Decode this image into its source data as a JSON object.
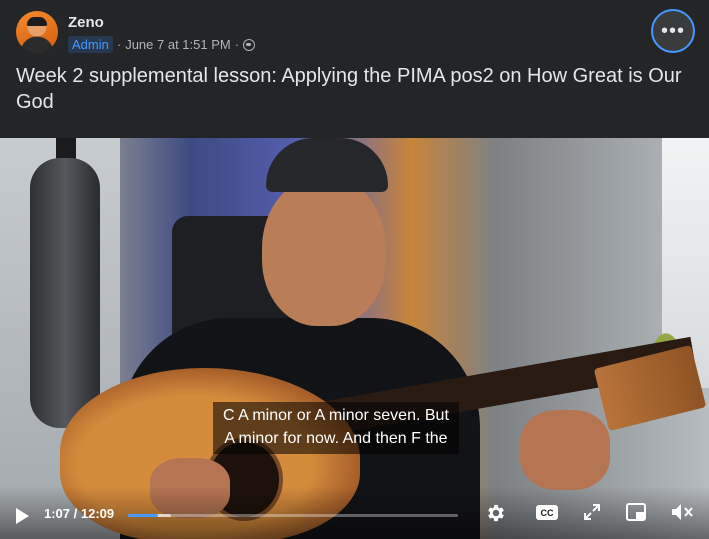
{
  "post": {
    "author": "Zeno",
    "role_badge": "Admin",
    "separator": "·",
    "date": "June 7 at 1:51 PM",
    "audience_icon": "globe-icon",
    "more_icon": "ellipsis-icon",
    "more_label": "•••",
    "caption": "Week 2 supplemental lesson: Applying the PIMA pos2 on How Great is Our God"
  },
  "video": {
    "subtitle_line1": "C A minor or A minor seven. But",
    "subtitle_line2": "A minor for now. And then F the",
    "current_time": "1:07",
    "duration": "12:09",
    "time_display": "1:07 / 12:09",
    "progress_fraction": 0.092,
    "buffered_fraction": 0.13,
    "cc_label": "CC",
    "icons": [
      "play-icon",
      "gear-icon",
      "cc-icon",
      "expand-icon",
      "pip-icon",
      "mute-icon"
    ]
  },
  "colors": {
    "background": "#242526",
    "text_primary": "#e4e6eb",
    "text_secondary": "#b0b3b8",
    "accent": "#4599ff",
    "badge_bg": "#263951"
  }
}
